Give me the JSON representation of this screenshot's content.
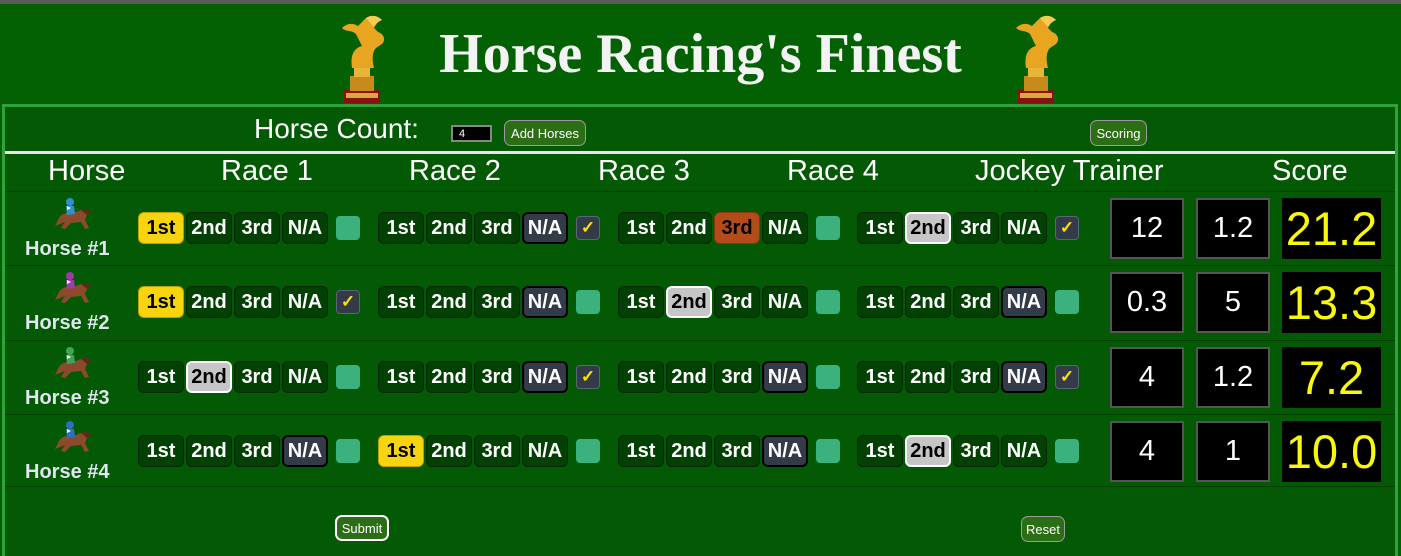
{
  "title": "Horse Racing's Finest",
  "controls": {
    "horse_count_label": "Horse Count:",
    "horse_count_value": "4",
    "add_horses_label": "Add Horses",
    "scoring_label": "Scoring",
    "submit_label": "Submit",
    "reset_label": "Reset"
  },
  "columns": {
    "horse": "Horse",
    "race1": "Race 1",
    "race2": "Race 2",
    "race3": "Race 3",
    "race4": "Race 4",
    "jockey_trainer": "Jockey Trainer",
    "score": "Score"
  },
  "position_labels": [
    "1st",
    "2nd",
    "3rd",
    "N/A"
  ],
  "checkbox_mark": "✓",
  "horses": [
    {
      "name": "Horse #1",
      "jockey_color": "#2f8fd0",
      "races": [
        {
          "selected": "1st",
          "checked": false
        },
        {
          "selected": "N/A",
          "checked": true
        },
        {
          "selected": "3rd",
          "checked": false
        },
        {
          "selected": "2nd",
          "checked": true
        }
      ],
      "jockey": "12",
      "trainer": "1.2",
      "score": "21.2"
    },
    {
      "name": "Horse #2",
      "jockey_color": "#a03aa8",
      "races": [
        {
          "selected": "1st",
          "checked": true
        },
        {
          "selected": "N/A",
          "checked": false
        },
        {
          "selected": "2nd",
          "checked": false
        },
        {
          "selected": "N/A",
          "checked": false
        }
      ],
      "jockey": "0.3",
      "trainer": "5",
      "score": "13.3"
    },
    {
      "name": "Horse #3",
      "jockey_color": "#3fa35a",
      "races": [
        {
          "selected": "2nd",
          "checked": false
        },
        {
          "selected": "N/A",
          "checked": true
        },
        {
          "selected": "N/A",
          "checked": false
        },
        {
          "selected": "N/A",
          "checked": true
        }
      ],
      "jockey": "4",
      "trainer": "1.2",
      "score": "7.2"
    },
    {
      "name": "Horse #4",
      "jockey_color": "#2a6fc8",
      "races": [
        {
          "selected": "N/A",
          "checked": false
        },
        {
          "selected": "1st",
          "checked": false
        },
        {
          "selected": "N/A",
          "checked": false
        },
        {
          "selected": "2nd",
          "checked": false
        }
      ],
      "jockey": "4",
      "trainer": "1",
      "score": "10.0"
    }
  ]
}
